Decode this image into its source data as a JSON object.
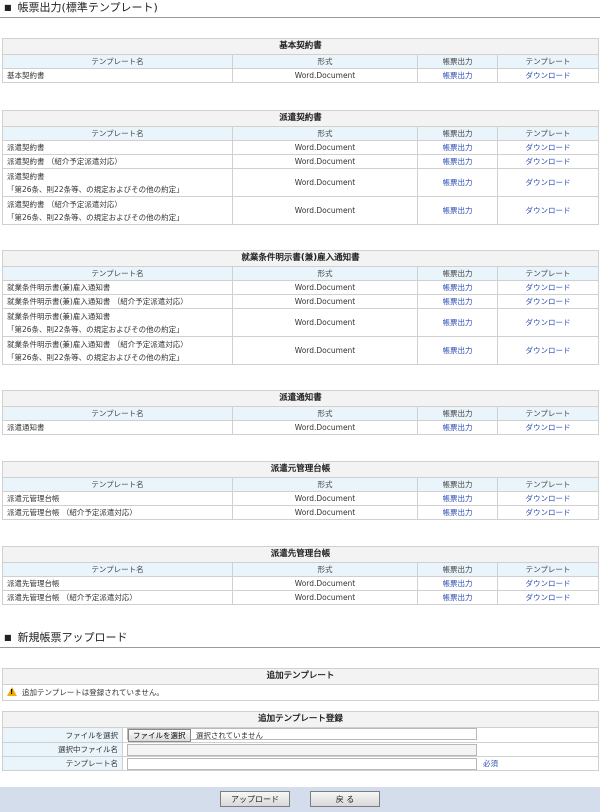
{
  "section1_title": "帳票出力(標準テンプレート)",
  "columns": [
    "テンプレート名",
    "形式",
    "帳票出力",
    "テンプレート"
  ],
  "tables": [
    {
      "caption": "基本契約書",
      "rows": [
        {
          "name": "基本契約書",
          "format": "Word.Document",
          "output": "帳票出力",
          "download": "ダウンロード"
        }
      ]
    },
    {
      "caption": "派遣契約書",
      "rows": [
        {
          "name": "派遣契約書",
          "format": "Word.Document",
          "output": "帳票出力",
          "download": "ダウンロード"
        },
        {
          "name": "派遣契約書 （紹介予定派遣対応）",
          "format": "Word.Document",
          "output": "帳票出力",
          "download": "ダウンロード"
        },
        {
          "name": "派遣契約書",
          "name2": "「第26条、則22条等、の規定およびその他の約定」",
          "format": "Word.Document",
          "output": "帳票出力",
          "download": "ダウンロード"
        },
        {
          "name": "派遣契約書 （紹介予定派遣対応）",
          "name2": "「第26条、則22条等、の規定およびその他の約定」",
          "format": "Word.Document",
          "output": "帳票出力",
          "download": "ダウンロード"
        }
      ]
    },
    {
      "caption": "就業条件明示書(兼)雇入通知書",
      "rows": [
        {
          "name": "就業条件明示書(兼)雇入通知書",
          "format": "Word.Document",
          "output": "帳票出力",
          "download": "ダウンロード"
        },
        {
          "name": "就業条件明示書(兼)雇入通知書 （紹介予定派遣対応）",
          "format": "Word.Document",
          "output": "帳票出力",
          "download": "ダウンロード"
        },
        {
          "name": "就業条件明示書(兼)雇入通知書",
          "name2": "「第26条、則22条等、の規定およびその他の約定」",
          "format": "Word.Document",
          "output": "帳票出力",
          "download": "ダウンロード"
        },
        {
          "name": "就業条件明示書(兼)雇入通知書 （紹介予定派遣対応）",
          "name2": "「第26条、則22条等、の規定およびその他の約定」",
          "format": "Word.Document",
          "output": "帳票出力",
          "download": "ダウンロード"
        }
      ]
    },
    {
      "caption": "派遣通知書",
      "rows": [
        {
          "name": "派遣通知書",
          "format": "Word.Document",
          "output": "帳票出力",
          "download": "ダウンロード"
        }
      ]
    },
    {
      "caption": "派遣元管理台帳",
      "rows": [
        {
          "name": "派遣元管理台帳",
          "format": "Word.Document",
          "output": "帳票出力",
          "download": "ダウンロード"
        },
        {
          "name": "派遣元管理台帳 （紹介予定派遣対応）",
          "format": "Word.Document",
          "output": "帳票出力",
          "download": "ダウンロード"
        }
      ]
    },
    {
      "caption": "派遣先管理台帳",
      "rows": [
        {
          "name": "派遣先管理台帳",
          "format": "Word.Document",
          "output": "帳票出力",
          "download": "ダウンロード"
        },
        {
          "name": "派遣先管理台帳 （紹介予定派遣対応）",
          "format": "Word.Document",
          "output": "帳票出力",
          "download": "ダウンロード"
        }
      ]
    }
  ],
  "section2_title": "新規帳票アップロード",
  "added_templates": {
    "caption": "追加テンプレート",
    "notice": "追加テンプレートは登録されていません。",
    "icon": "warning-icon"
  },
  "register": {
    "caption": "追加テンプレート登録",
    "file_label": "ファイルを選択",
    "file_button": "ファイルを選択",
    "file_status": "選択されていません",
    "selected_label": "選択中ファイル名",
    "selected_value": "",
    "name_label": "テンプレート名",
    "name_value": "",
    "required": "必須"
  },
  "buttons": {
    "upload": "アップロード",
    "back": "戻 る"
  },
  "colors": {
    "link": "#2e4fb5",
    "header_bg": "#eaf4fb",
    "footer_bg": "#d3ddeb",
    "warning": "#f0b000"
  }
}
